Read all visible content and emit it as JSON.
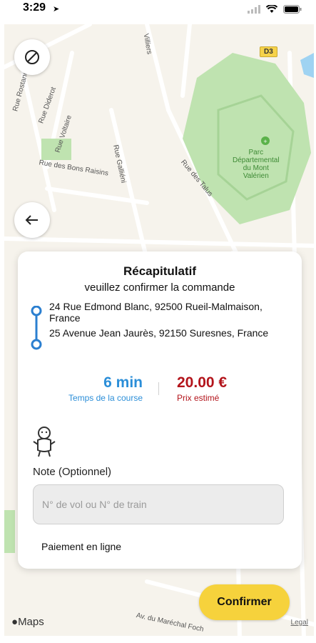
{
  "status_bar": {
    "time": "3:29"
  },
  "map": {
    "park_label_line1": "Parc",
    "park_label_line2": "Départemental",
    "park_label_line3": "du Mont",
    "park_label_line4": "Valérien",
    "road_badge": "D3",
    "streets": [
      "Rue Diderot",
      "Rue Rostand",
      "Rue Voltaire",
      "Rue Galliéni",
      "Rue des Bons Raisins",
      "Rue des Talus",
      "Av. du Maréchal Foch",
      "Villiers"
    ],
    "brand": "Maps",
    "legal": "Legal"
  },
  "summary": {
    "title": "Récapitulatif",
    "subtitle": "veuillez confirmer la commande",
    "pickup_address": "24 Rue Edmond Blanc, 92500 Rueil-Malmaison, France",
    "dropoff_address": "25 Avenue Jean Jaurès, 92150 Suresnes, France",
    "duration_value": "6 min",
    "duration_label": "Temps de la course",
    "price_value": "20.00 €",
    "price_label": "Prix estimé",
    "note_label": "Note (Optionnel)",
    "note_placeholder": "N° de vol ou N° de train",
    "note_value": "",
    "payment_label": "Paiement en ligne"
  },
  "actions": {
    "confirm_label": "Confirmer"
  },
  "colors": {
    "accent_yellow": "#f6d23c",
    "blue": "#2b8ed8",
    "red": "#b3141b",
    "park_green": "#bfe3b0"
  }
}
